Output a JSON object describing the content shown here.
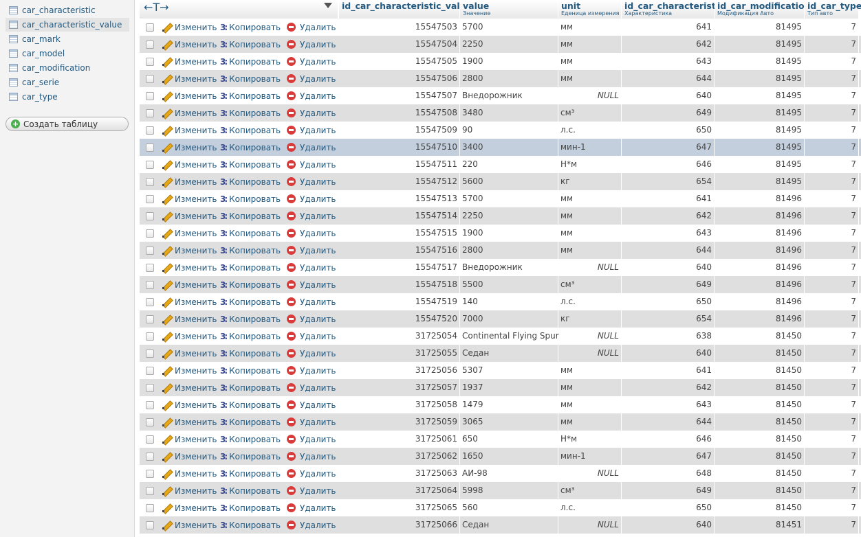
{
  "sidebar": {
    "tables": [
      "car_characteristic",
      "car_characteristic_value",
      "car_mark",
      "car_model",
      "car_modification",
      "car_serie",
      "car_type"
    ],
    "active_index": 1,
    "create_label": "Создать таблицу"
  },
  "table": {
    "arrows": "←T→",
    "columns": [
      {
        "title": "id_car_characteristic_value",
        "sub": ""
      },
      {
        "title": "value",
        "sub": "Значение"
      },
      {
        "title": "unit",
        "sub": "Еденица измерения"
      },
      {
        "title": "id_car_characteristic",
        "sub": "Характеристика"
      },
      {
        "title": "id_car_modification",
        "sub": "Модификация Авто"
      },
      {
        "title": "id_car_type",
        "sub": "Тип авто"
      }
    ],
    "actions": {
      "edit": "Изменить",
      "copy": "Копировать",
      "delete": "Удалить"
    },
    "null_label": "NULL",
    "marked_row": 7,
    "rows": [
      [
        "15547503",
        "5700",
        "мм",
        "641",
        "81495",
        "7"
      ],
      [
        "15547504",
        "2250",
        "мм",
        "642",
        "81495",
        "7"
      ],
      [
        "15547505",
        "1900",
        "мм",
        "643",
        "81495",
        "7"
      ],
      [
        "15547506",
        "2800",
        "мм",
        "644",
        "81495",
        "7"
      ],
      [
        "15547507",
        "Внедорожник",
        null,
        "640",
        "81495",
        "7"
      ],
      [
        "15547508",
        "3480",
        "см³",
        "649",
        "81495",
        "7"
      ],
      [
        "15547509",
        "90",
        "л.с.",
        "650",
        "81495",
        "7"
      ],
      [
        "15547510",
        "3400",
        "мин-1",
        "647",
        "81495",
        "7"
      ],
      [
        "15547511",
        "220",
        "Н*м",
        "646",
        "81495",
        "7"
      ],
      [
        "15547512",
        "5600",
        "кг",
        "654",
        "81495",
        "7"
      ],
      [
        "15547513",
        "5700",
        "мм",
        "641",
        "81496",
        "7"
      ],
      [
        "15547514",
        "2250",
        "мм",
        "642",
        "81496",
        "7"
      ],
      [
        "15547515",
        "1900",
        "мм",
        "643",
        "81496",
        "7"
      ],
      [
        "15547516",
        "2800",
        "мм",
        "644",
        "81496",
        "7"
      ],
      [
        "15547517",
        "Внедорожник",
        null,
        "640",
        "81496",
        "7"
      ],
      [
        "15547518",
        "5500",
        "см³",
        "649",
        "81496",
        "7"
      ],
      [
        "15547519",
        "140",
        "л.с.",
        "650",
        "81496",
        "7"
      ],
      [
        "15547520",
        "7000",
        "кг",
        "654",
        "81496",
        "7"
      ],
      [
        "31725054",
        "Continental Flying Spur",
        null,
        "638",
        "81450",
        "7"
      ],
      [
        "31725055",
        "Седан",
        null,
        "640",
        "81450",
        "7"
      ],
      [
        "31725056",
        "5307",
        "мм",
        "641",
        "81450",
        "7"
      ],
      [
        "31725057",
        "1937",
        "мм",
        "642",
        "81450",
        "7"
      ],
      [
        "31725058",
        "1479",
        "мм",
        "643",
        "81450",
        "7"
      ],
      [
        "31725059",
        "3065",
        "мм",
        "644",
        "81450",
        "7"
      ],
      [
        "31725061",
        "650",
        "Н*м",
        "646",
        "81450",
        "7"
      ],
      [
        "31725062",
        "1650",
        "мин-1",
        "647",
        "81450",
        "7"
      ],
      [
        "31725063",
        "АИ-98",
        null,
        "648",
        "81450",
        "7"
      ],
      [
        "31725064",
        "5998",
        "см³",
        "649",
        "81450",
        "7"
      ],
      [
        "31725065",
        "560",
        "л.с.",
        "650",
        "81450",
        "7"
      ],
      [
        "31725066",
        "Седан",
        null,
        "640",
        "81451",
        "7"
      ]
    ]
  }
}
